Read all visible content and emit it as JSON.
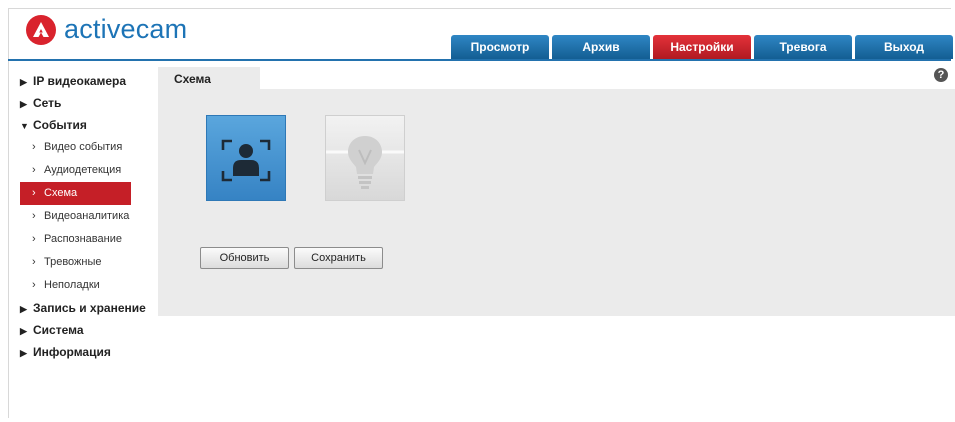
{
  "brand": {
    "name": "activecam",
    "color": "#1d74b6",
    "mark_color": "#d9232d"
  },
  "topnav": {
    "tabs": [
      {
        "label": "Просмотр",
        "active": false
      },
      {
        "label": "Архив",
        "active": false
      },
      {
        "label": "Настройки",
        "active": true
      },
      {
        "label": "Тревога",
        "active": false
      },
      {
        "label": "Выход",
        "active": false
      }
    ],
    "accent": "#1b6aa5",
    "active_color": "#c51f27"
  },
  "sidebar": {
    "sections": [
      {
        "label": "IP видеокамера",
        "expanded": false
      },
      {
        "label": "Сеть",
        "expanded": false
      },
      {
        "label": "События",
        "expanded": true,
        "items": [
          {
            "label": "Видео события"
          },
          {
            "label": "Аудиодетекция"
          },
          {
            "label": "Схема",
            "active": true
          },
          {
            "label": "Видеоаналитика"
          },
          {
            "label": "Распознавание"
          },
          {
            "label": "Тревожные"
          },
          {
            "label": "Неполадки"
          }
        ]
      },
      {
        "label": "Запись и хранение",
        "expanded": false
      },
      {
        "label": "Система",
        "expanded": false
      },
      {
        "label": "Информация",
        "expanded": false
      }
    ]
  },
  "content": {
    "tab_label": "Схема",
    "help_icon": "?",
    "tiles": [
      {
        "icon": "face-detection-icon",
        "enabled": true
      },
      {
        "icon": "light-bulb-icon",
        "enabled": false
      }
    ],
    "buttons": {
      "refresh": "Обновить",
      "save": "Сохранить"
    }
  }
}
